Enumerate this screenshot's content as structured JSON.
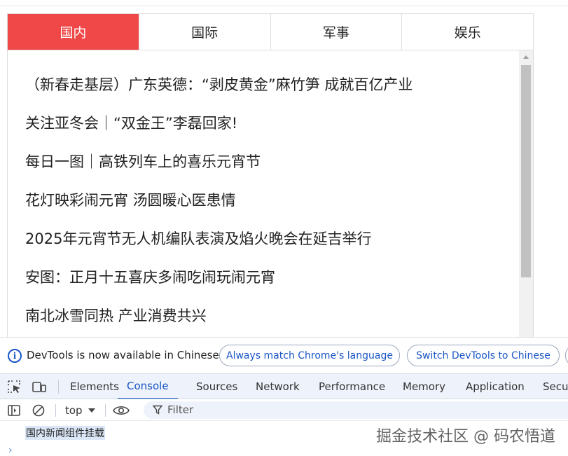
{
  "news_widget": {
    "tabs": [
      {
        "label": "国内",
        "active": true
      },
      {
        "label": "国际",
        "active": false
      },
      {
        "label": "军事",
        "active": false
      },
      {
        "label": "娱乐",
        "active": false
      }
    ],
    "items": [
      "（新春走基层）广东英德：“剥皮黄金”麻竹笋 成就百亿产业",
      "关注亚冬会｜“双金王”李磊回家!",
      "每日一图｜高铁列车上的喜乐元宵节",
      "花灯映彩闹元宵 汤圆暖心医患情",
      "2025年元宵节无人机编队表演及焰火晚会在延吉举行",
      "安图：正月十五喜庆多闹吃闹玩闹元宵",
      "南北冰雪同热 产业消费共兴"
    ],
    "active_color": "#f04848"
  },
  "devtools_banner": {
    "message": "DevTools is now available in Chinese!",
    "button_match": "Always match Chrome's language",
    "button_switch": "Switch DevTools to Chinese"
  },
  "devtools_tabs": [
    {
      "label": "Elements",
      "active": false
    },
    {
      "label": "Console",
      "active": true
    },
    {
      "label": "Sources",
      "active": false
    },
    {
      "label": "Network",
      "active": false
    },
    {
      "label": "Performance",
      "active": false
    },
    {
      "label": "Memory",
      "active": false
    },
    {
      "label": "Application",
      "active": false
    },
    {
      "label": "Secu",
      "active": false
    }
  ],
  "console_toolbar": {
    "context": "top",
    "filter_placeholder": "Filter"
  },
  "console_output": {
    "log": "国内新闻组件挂载",
    "prompt": "›"
  },
  "watermark": "掘金技术社区 @ 码农悟道",
  "colors": {
    "accent": "#1a56c5"
  }
}
